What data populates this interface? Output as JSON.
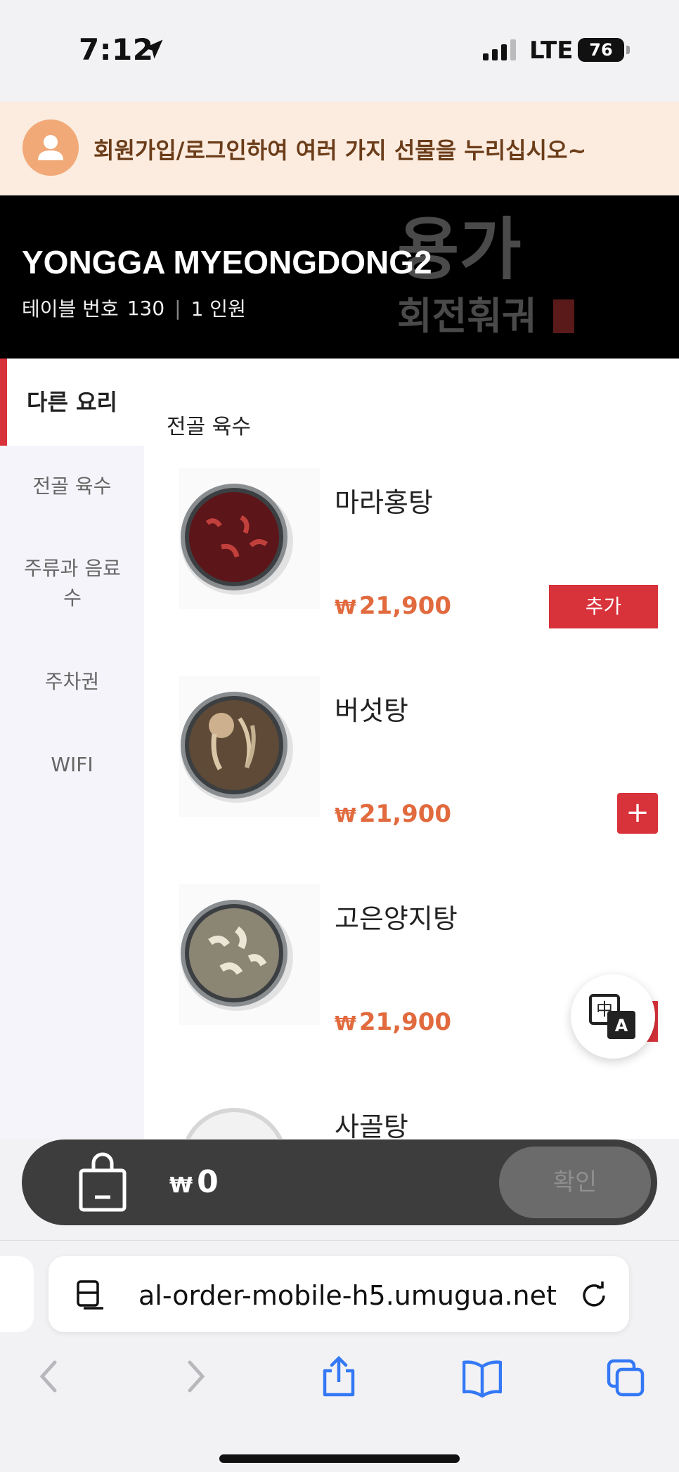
{
  "status_bar": {
    "time": "7:12",
    "network": "LTE",
    "battery": "76"
  },
  "promo": {
    "text": "회원가입/로그인하여 여러 가지 선물을 누리십시오~"
  },
  "store": {
    "name": "YONGGA MYEONGDONG2",
    "table_label": "테이블 번호",
    "table_number": "130",
    "party_size": "1 인원",
    "logo_text": "용가",
    "logo_subtext": "회전훠궈"
  },
  "sidebar": {
    "items": [
      {
        "label": "다른 요리"
      },
      {
        "label": "전골 육수"
      },
      {
        "label": "주류과 음료수"
      },
      {
        "label": "주차권"
      },
      {
        "label": "WIFI"
      }
    ]
  },
  "menu": {
    "section_title": "전골 육수",
    "items": [
      {
        "name": "마라홍탕",
        "currency": "₩",
        "price": "21,900",
        "button": "추가"
      },
      {
        "name": "버섯탕",
        "currency": "₩",
        "price": "21,900",
        "button": "+"
      },
      {
        "name": "고은양지탕",
        "currency": "₩",
        "price": "21,900"
      },
      {
        "name": "사골탕"
      }
    ]
  },
  "cart": {
    "currency": "₩",
    "total": "0",
    "confirm_label": "확인"
  },
  "browser": {
    "url": "al-order-mobile-h5.umugua.net"
  },
  "colors": {
    "accent": "#d8323a",
    "price": "#e16a3e",
    "header_bg": "#000000",
    "promo_bg": "#fcecdf",
    "sidebar_bg": "#f4f4fa",
    "cart_bg": "#3d3d3d"
  }
}
